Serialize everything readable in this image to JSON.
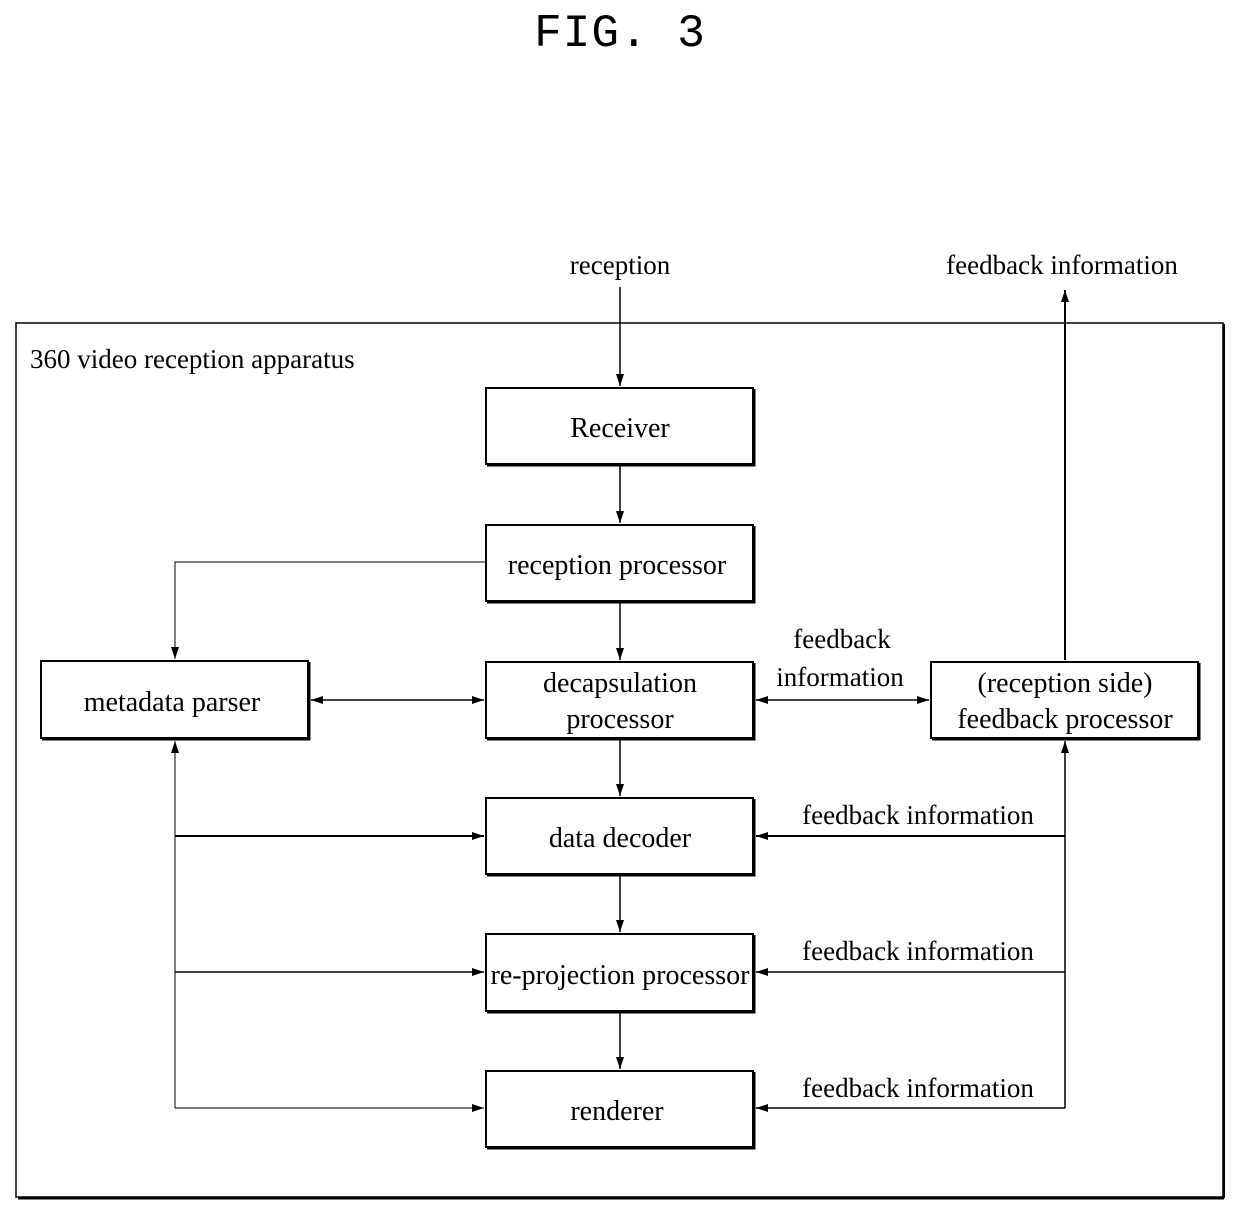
{
  "figure": {
    "title": "FIG. 3"
  },
  "apparatus": {
    "label": "360 video reception apparatus"
  },
  "external_labels": {
    "input": "reception",
    "output": "feedback information"
  },
  "blocks": {
    "receiver": {
      "lines": [
        "Receiver"
      ]
    },
    "reception_processor": {
      "lines": [
        "reception processor"
      ]
    },
    "decapsulation_processor": {
      "lines": [
        "decapsulation",
        "processor"
      ]
    },
    "metadata_parser": {
      "lines": [
        "metadata parser"
      ]
    },
    "feedback_processor": {
      "lines": [
        "(reception side)",
        "feedback processor"
      ]
    },
    "data_decoder": {
      "lines": [
        "data decoder"
      ]
    },
    "reprojection_processor": {
      "lines": [
        "re-projection processor"
      ]
    },
    "renderer": {
      "lines": [
        "renderer"
      ]
    }
  },
  "edge_labels": {
    "decap_feedback": [
      "feedback",
      "information"
    ],
    "decoder_feedback": "feedback information",
    "reprojection_feedback": "feedback information",
    "renderer_feedback": "feedback information"
  }
}
